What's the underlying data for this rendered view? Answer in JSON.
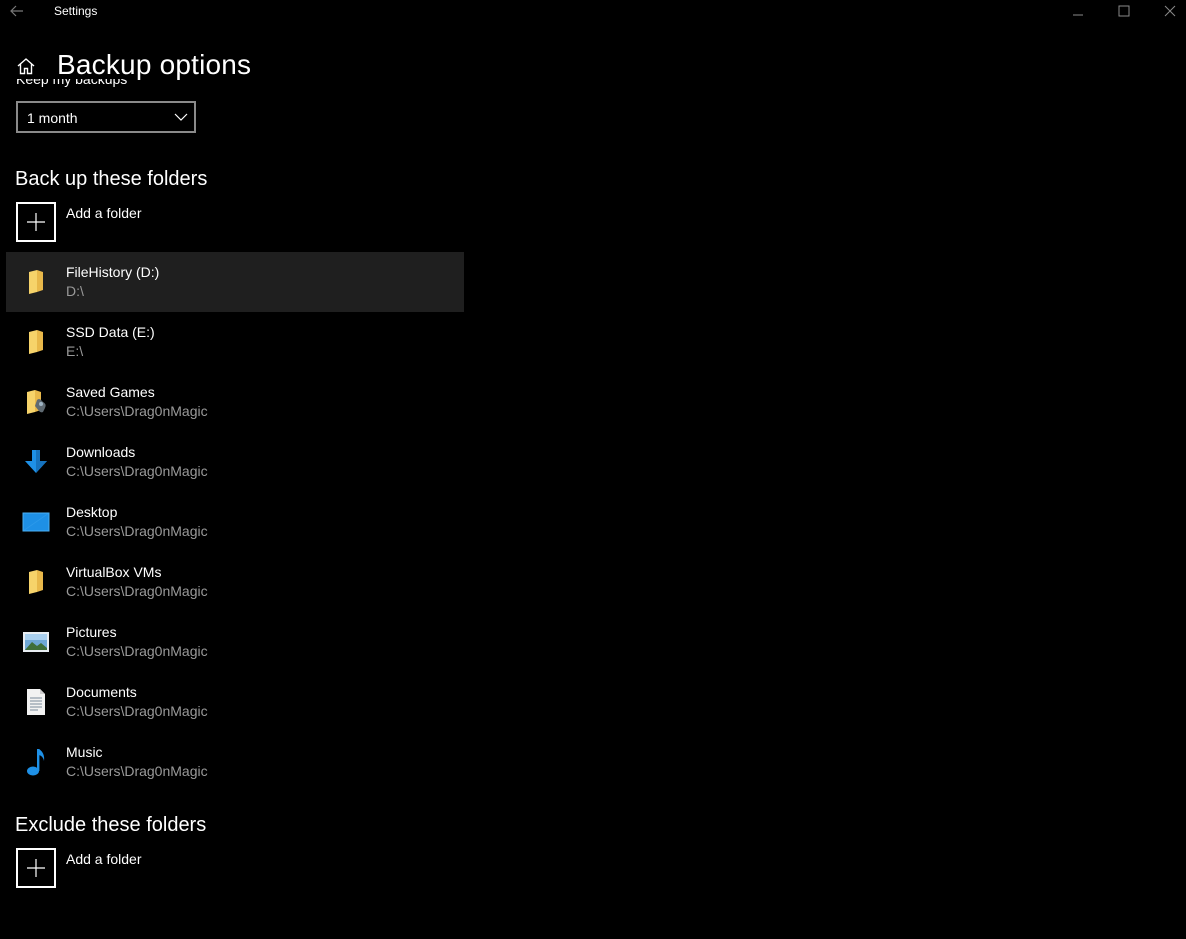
{
  "window": {
    "title": "Settings",
    "back_icon": "back-arrow-icon",
    "minimize_icon": "minimize-icon",
    "maximize_icon": "maximize-icon",
    "close_icon": "close-icon"
  },
  "header": {
    "home_icon": "home-icon",
    "title": "Backup options"
  },
  "keep_backups": {
    "label": "Keep my backups",
    "selected": "1 month"
  },
  "backup_section": {
    "title": "Back up these folders",
    "add_label": "Add a folder",
    "folders": [
      {
        "name": "FileHistory (D:)",
        "path": "D:\\",
        "icon": "folder-icon",
        "selected": true
      },
      {
        "name": "SSD Data (E:)",
        "path": "E:\\",
        "icon": "folder-icon",
        "selected": false
      },
      {
        "name": "Saved Games",
        "path": "C:\\Users\\Drag0nMagic",
        "icon": "saved-games-icon",
        "selected": false
      },
      {
        "name": "Downloads",
        "path": "C:\\Users\\Drag0nMagic",
        "icon": "downloads-icon",
        "selected": false
      },
      {
        "name": "Desktop",
        "path": "C:\\Users\\Drag0nMagic",
        "icon": "desktop-icon",
        "selected": false
      },
      {
        "name": "VirtualBox VMs",
        "path": "C:\\Users\\Drag0nMagic",
        "icon": "folder-icon",
        "selected": false
      },
      {
        "name": "Pictures",
        "path": "C:\\Users\\Drag0nMagic",
        "icon": "pictures-icon",
        "selected": false
      },
      {
        "name": "Documents",
        "path": "C:\\Users\\Drag0nMagic",
        "icon": "documents-icon",
        "selected": false
      },
      {
        "name": "Music",
        "path": "C:\\Users\\Drag0nMagic",
        "icon": "music-icon",
        "selected": false
      }
    ]
  },
  "exclude_section": {
    "title": "Exclude these folders",
    "add_label": "Add a folder"
  },
  "colors": {
    "background": "#000000",
    "selected_row": "#1f1f1f",
    "secondary_text": "#9a9a9a",
    "folder_yellow": "#f6d36a",
    "accent_blue": "#1e90e6"
  }
}
